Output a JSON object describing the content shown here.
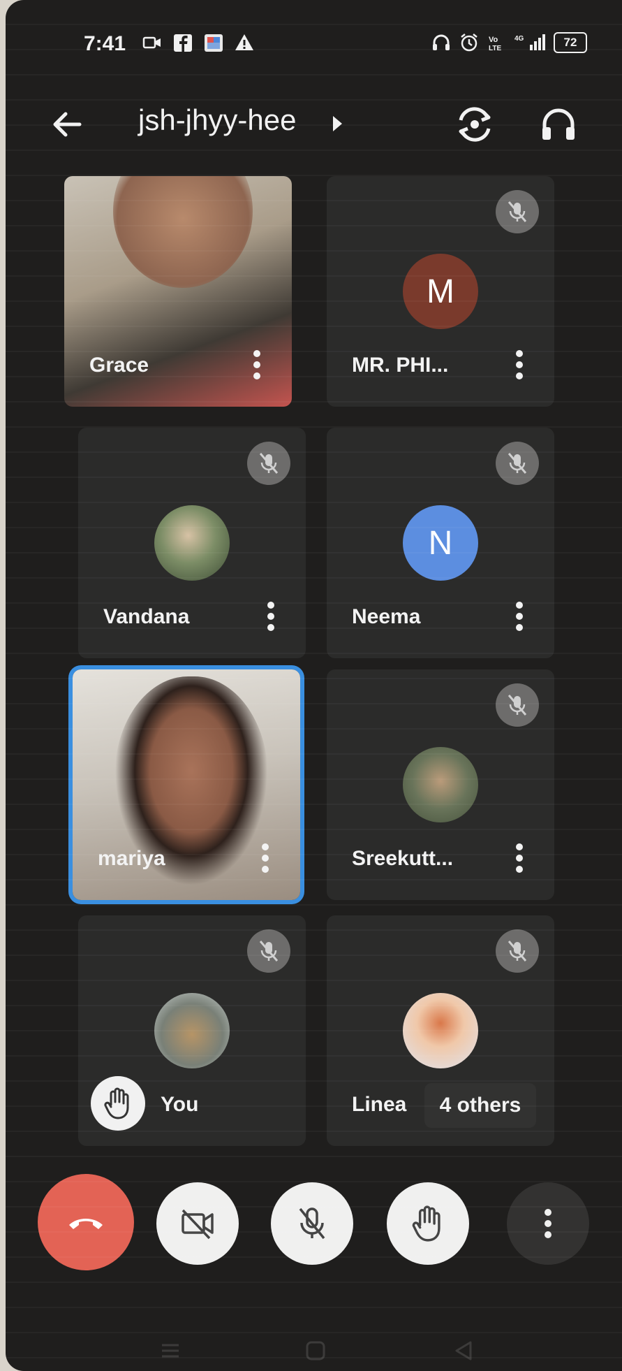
{
  "status_bar": {
    "time": "7:41",
    "battery": "72",
    "left_icons": [
      "screen-record-icon",
      "facebook-icon",
      "app-notification-icon",
      "warning-icon"
    ],
    "right_icons": [
      "headset-icon",
      "alarm-icon",
      "volte-icon",
      "signal-icon"
    ]
  },
  "toolbar": {
    "title": "jsh-jhyy-hee"
  },
  "participants": [
    {
      "name": "Grace",
      "muted": false,
      "video": true
    },
    {
      "name": "MR. PHI...",
      "muted": true,
      "avatar_letter": "M",
      "avatar_color": "#7a3a2c"
    },
    {
      "name": "Vandana",
      "muted": true
    },
    {
      "name": "Neema",
      "muted": true,
      "avatar_letter": "N",
      "avatar_color": "#5c8ee0"
    },
    {
      "name": "mariya",
      "muted": false,
      "video": true,
      "active_speaker": true
    },
    {
      "name": "Sreekutt...",
      "muted": true
    },
    {
      "name": "You",
      "muted": true,
      "hand_raised": true
    },
    {
      "name": "Linea",
      "muted": true
    }
  ],
  "others_label": "4 others",
  "colors": {
    "background": "#1f1e1d",
    "tile": "#2b2b2a",
    "end_call": "#e36355",
    "active_border": "#3a8fe0",
    "control_button": "#f0f0ef"
  }
}
